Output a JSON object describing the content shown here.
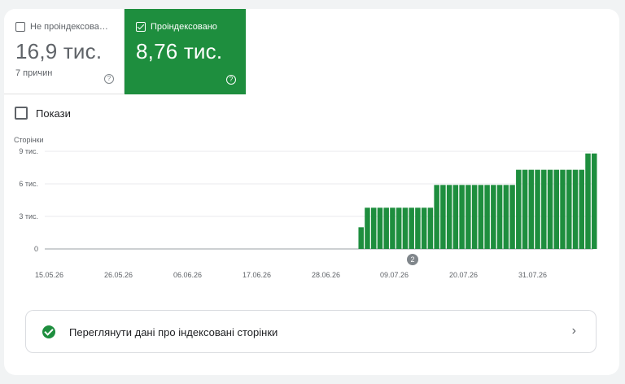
{
  "tiles": {
    "not_indexed": {
      "label": "Не проіндексова…",
      "value": "16,9 тис.",
      "sub": "7 причин",
      "checked": false
    },
    "indexed": {
      "label": "Проіндексовано",
      "value": "8,76 тис.",
      "checked": true,
      "color": "#1e8e3e"
    }
  },
  "impressions": {
    "label": "Покази",
    "checked": false
  },
  "chart_data": {
    "type": "bar",
    "ylabel": "Сторінки",
    "yticks": [
      "9 тис.",
      "6 тис.",
      "3 тис.",
      "0"
    ],
    "ytick_values": [
      9000,
      6000,
      3000,
      0
    ],
    "ylim": [
      0,
      9000
    ],
    "xticks": [
      "15.05.26",
      "26.05.26",
      "06.06.26",
      "17.06.26",
      "28.06.26",
      "09.07.26",
      "20.07.26",
      "31.07.26"
    ],
    "annotation": "2",
    "bar_color": "#1e8e3e",
    "grid": true,
    "day_count": 86,
    "values": [
      0,
      0,
      0,
      0,
      0,
      0,
      0,
      0,
      0,
      0,
      0,
      0,
      0,
      0,
      0,
      0,
      0,
      0,
      0,
      0,
      0,
      0,
      0,
      0,
      0,
      0,
      0,
      0,
      0,
      0,
      0,
      0,
      0,
      0,
      0,
      0,
      0,
      0,
      0,
      0,
      0,
      0,
      0,
      0,
      0,
      0,
      0,
      0,
      0,
      2000,
      3800,
      3800,
      3800,
      3800,
      3800,
      3800,
      3800,
      3800,
      3800,
      3800,
      3800,
      5900,
      5900,
      5900,
      5900,
      5900,
      5900,
      5900,
      5900,
      5900,
      5900,
      5900,
      5900,
      5900,
      7300,
      7300,
      7300,
      7300,
      7300,
      7300,
      7300,
      7300,
      7300,
      7300,
      7300,
      8800,
      8800
    ]
  },
  "link": {
    "label": "Переглянути дані про індексовані сторінки"
  }
}
